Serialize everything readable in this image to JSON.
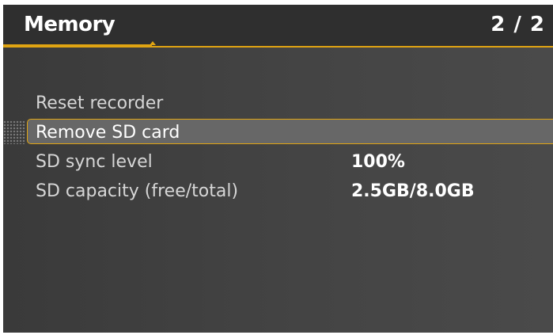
{
  "header": {
    "title": "Memory",
    "page_indicator": "2 / 2",
    "progress_fraction": 0.27
  },
  "menu": {
    "items": [
      {
        "label": "Reset recorder",
        "value": null,
        "selected": false
      },
      {
        "label": "Remove SD card",
        "value": null,
        "selected": true
      },
      {
        "label": "SD sync level",
        "value": "100%",
        "selected": false
      },
      {
        "label": "SD capacity (free/total)",
        "value": "2.5GB/8.0GB",
        "selected": false
      }
    ]
  },
  "colors": {
    "accent": "#e0a412",
    "header_bg": "#2f2f2f",
    "screen_bg": "#444444",
    "selected_bg": "#676767"
  }
}
